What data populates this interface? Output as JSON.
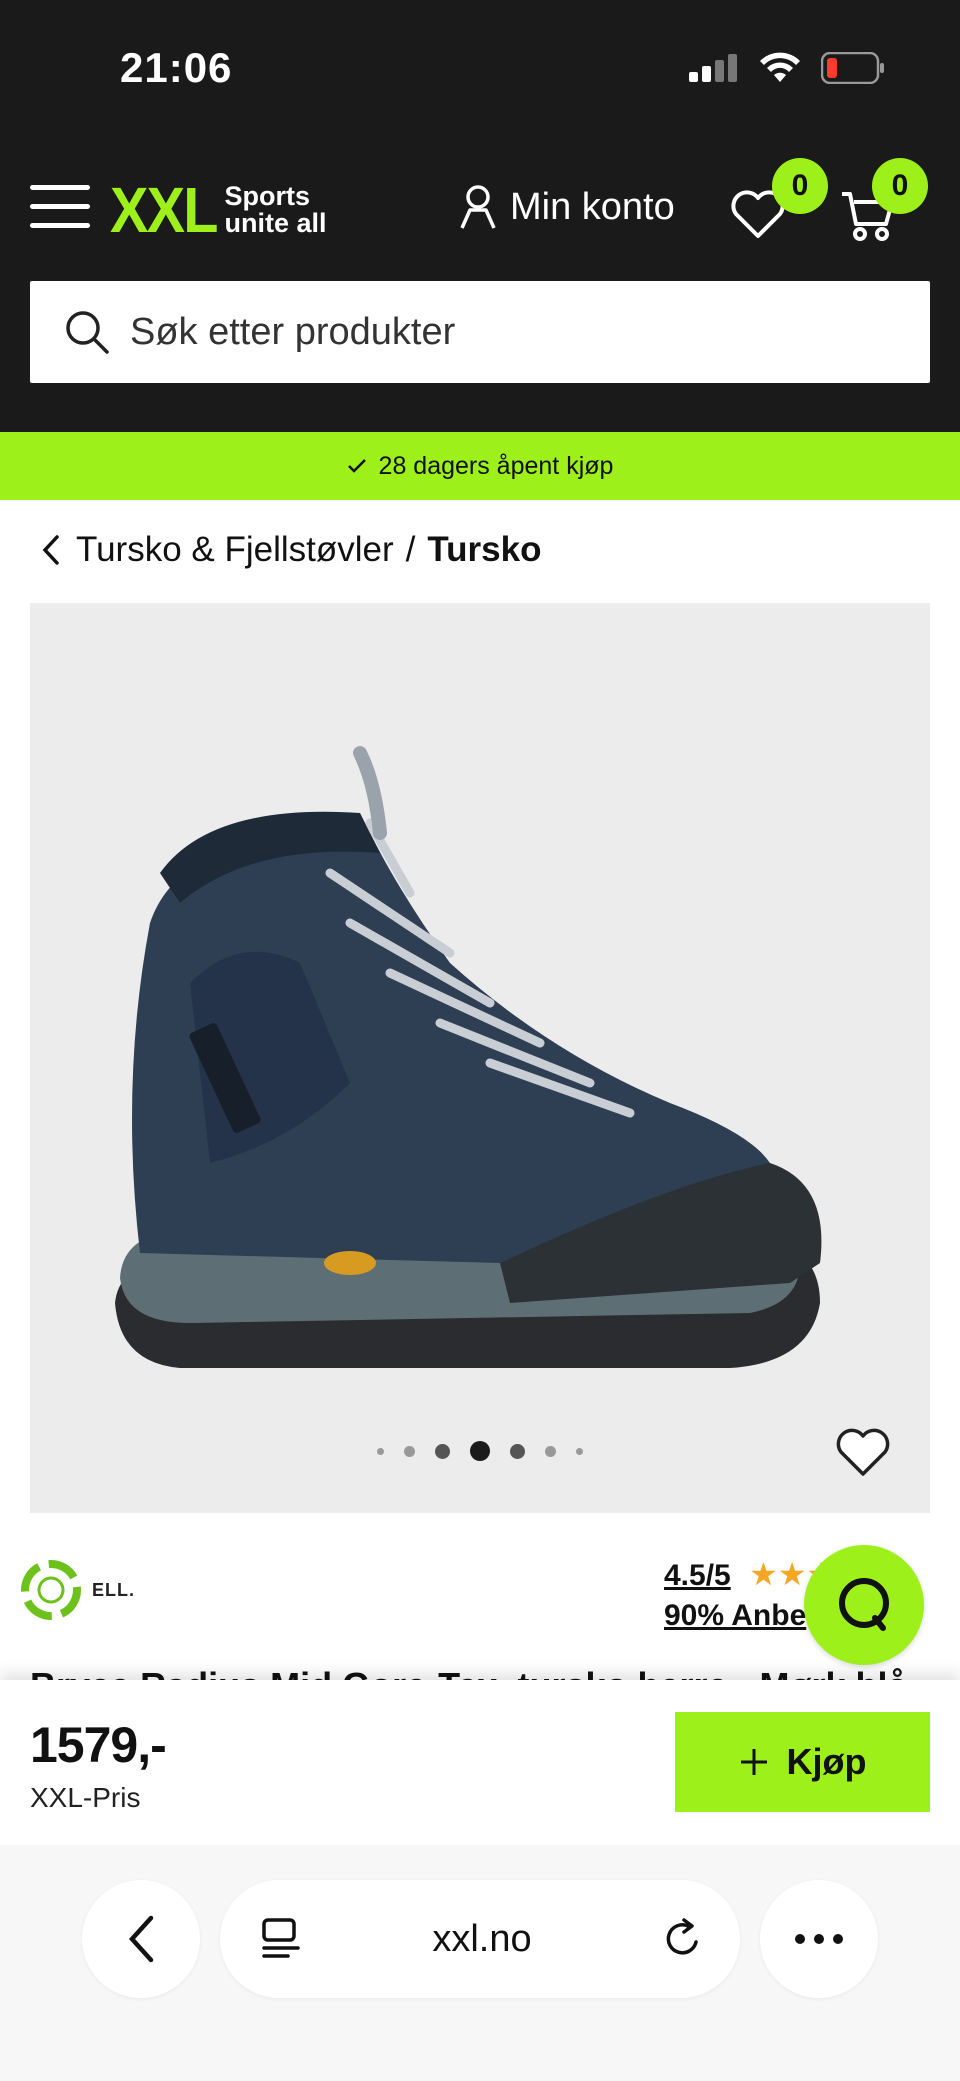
{
  "status_bar": {
    "time": "21:06"
  },
  "header": {
    "logo_main": "XXL",
    "logo_tagline_1": "Sports",
    "logo_tagline_2": "unite all",
    "account_label": "Min konto",
    "wishlist_count": "0",
    "cart_count": "0",
    "search_placeholder": "Søk etter produkter"
  },
  "promo": {
    "text": "28 dagers åpent kjøp"
  },
  "breadcrumb": {
    "parent": "Tursko & Fjellstøvler",
    "separator": "/",
    "current": "Tursko"
  },
  "product": {
    "brand_partial": "ELL.",
    "rating_score": "4.5/5",
    "rating_value": 4.5,
    "rating_max": 5,
    "recommend_text": "90% Anbe",
    "title": "Bryce Radius Mid Gore-Tex, tursko herre - Mørk blå",
    "image_count": 7,
    "image_active_index": 3
  },
  "buy_bar": {
    "price": "1579,-",
    "price_label": "XXL-Pris",
    "buy_label": "Kjøp"
  },
  "browser": {
    "url": "xxl.no"
  },
  "colors": {
    "accent": "#9ef01a",
    "header_bg": "#1a1a1a"
  }
}
